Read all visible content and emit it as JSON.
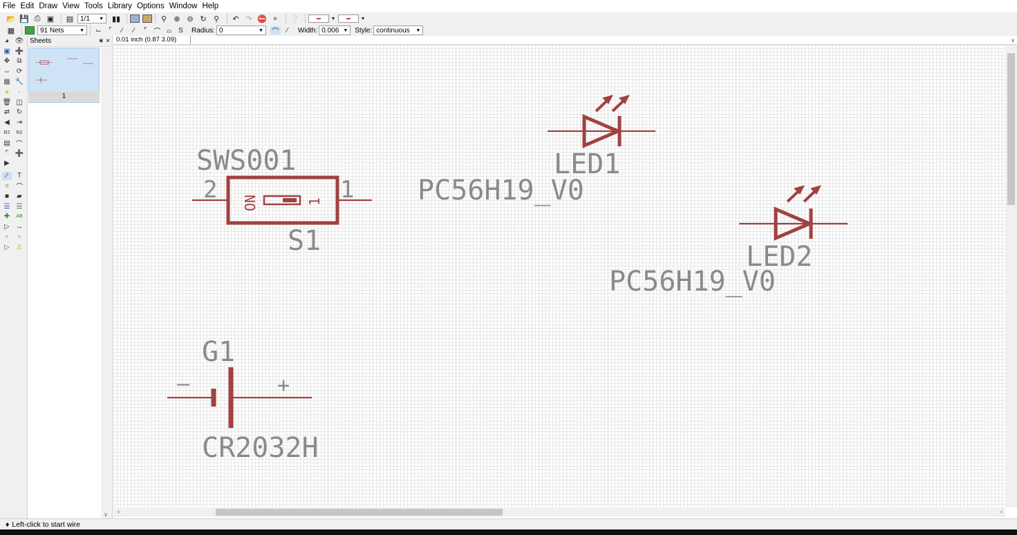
{
  "menu": [
    "File",
    "Edit",
    "Draw",
    "View",
    "Tools",
    "Library",
    "Options",
    "Window",
    "Help"
  ],
  "toolbar": {
    "sheet_select": "1/1"
  },
  "toolbar2": {
    "net_class": "91 Nets",
    "radius_label": "Radius:",
    "radius_value": "0",
    "width_label": "Width:",
    "width_value": "0.006",
    "style_label": "Style:",
    "style_value": "continuous"
  },
  "sheets_panel": {
    "title": "Sheets",
    "sheet_number": "1"
  },
  "coord_readout": "0.01 inch (0.87 3.09)",
  "command_line": "",
  "schematic": {
    "s1": {
      "name": "SWS001",
      "ref": "S1",
      "pin_left": "2",
      "pin_right": "1",
      "body_text_on": "ON",
      "body_text_pin": "1"
    },
    "led1": {
      "ref": "LED1",
      "value": "PC56H19_V0"
    },
    "led2": {
      "ref": "LED2",
      "value": "PC56H19_V0"
    },
    "g1": {
      "ref": "G1",
      "value": "CR2032H",
      "minus": "—",
      "plus": "+"
    }
  },
  "colors": {
    "symbol": "#a14141",
    "text": "#8a8a8a",
    "grid": "#e6e6e6"
  },
  "status": "Left-click to start wire"
}
